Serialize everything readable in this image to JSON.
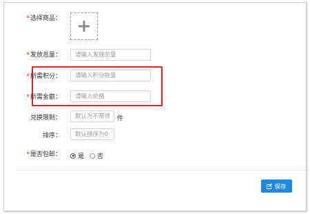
{
  "form": {
    "product": {
      "label": "选择商品：",
      "required": "*",
      "icon": "plus-icon"
    },
    "total": {
      "label": "发放总量：",
      "required": "*",
      "placeholder": "请输入发放总量"
    },
    "points": {
      "label": "所需积分：",
      "required": "*",
      "placeholder": "请输入积分数量"
    },
    "amount": {
      "label": "所需金额：",
      "required": "*",
      "placeholder": "请输入价格"
    },
    "limit": {
      "label": "兑换限制：",
      "placeholder": "默认为不限领",
      "unit": "件"
    },
    "sort": {
      "label": "排序：",
      "placeholder": "默认排序为0"
    },
    "shipping": {
      "label": "是否包邮：",
      "required": "*",
      "options": [
        {
          "label": "是",
          "checked": true
        },
        {
          "label": "否",
          "checked": false
        }
      ]
    }
  },
  "actions": {
    "save_label": "保存",
    "save_icon": "edit-icon"
  },
  "colors": {
    "accent": "#1e88e5",
    "required": "#e02020",
    "highlight": "#e0201f"
  }
}
